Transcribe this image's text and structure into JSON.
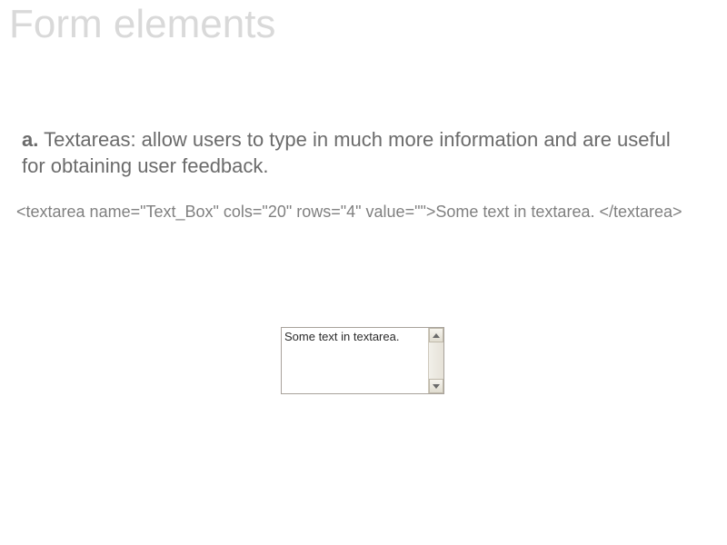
{
  "title": "Form elements",
  "body": {
    "marker": "a.",
    "text": "Textareas: allow users to type in much more information and are useful for obtaining user feedback."
  },
  "code": "<textarea name=\"Text_Box\" cols=\"20\" rows=\"4\" value=\"\">Some text in textarea. </textarea>",
  "textarea": {
    "content": "Some text in textarea."
  }
}
